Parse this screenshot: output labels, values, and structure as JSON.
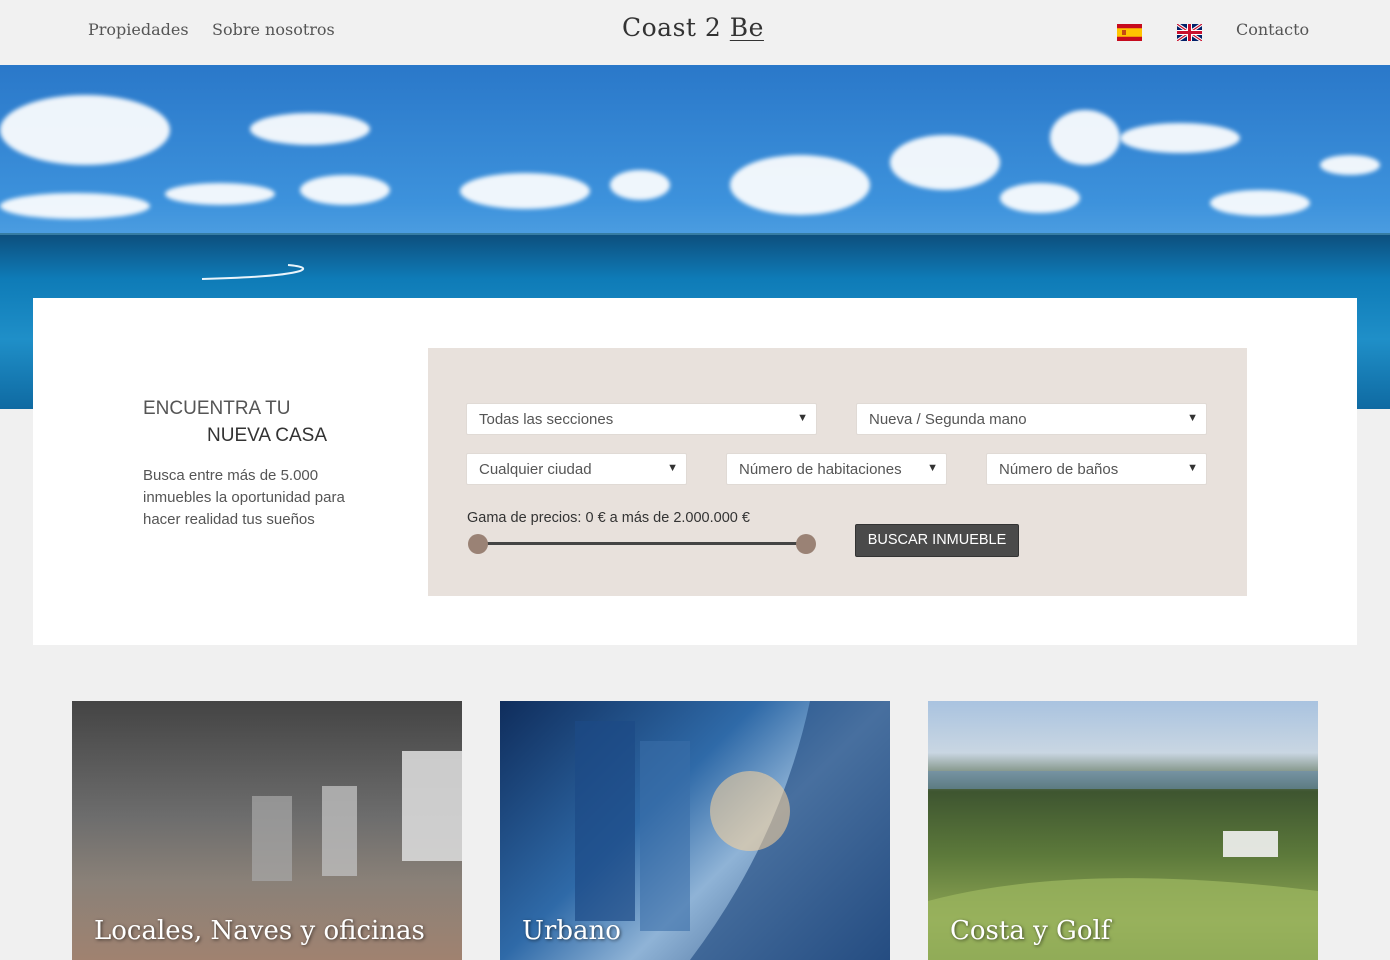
{
  "nav": {
    "properties": "Propiedades",
    "about": "Sobre nosotros",
    "logo": "Coast 2",
    "logo_accent": "Be",
    "contact": "Contacto",
    "flag_es": "spain-flag-icon",
    "flag_uk": "uk-flag-icon"
  },
  "search": {
    "title_line1": "ENCUENTRA TU",
    "title_line2": "NUEVA CASA",
    "description": "Busca entre más de 5.000 inmuebles la oportunidad para hacer realidad tus sueños",
    "section_select": "Todas las secciones",
    "condition_select": "Nueva / Segunda mano",
    "city_select": "Cualquier ciudad",
    "rooms_select": "Número de habitaciones",
    "baths_select": "Número de baños",
    "price_label": "Gama de precios: 0 € a más de 2.000.000 €",
    "price_min": 0,
    "price_max": 2000000,
    "button": "BUSCAR INMUEBLE"
  },
  "categories": [
    {
      "label": "Locales, Naves y oficinas"
    },
    {
      "label": "Urbano"
    },
    {
      "label": "Costa y Golf"
    }
  ],
  "colors": {
    "panel_bg": "#e8e1dc",
    "slider_thumb": "#9a8275",
    "button_bg": "#4a4a4a"
  }
}
